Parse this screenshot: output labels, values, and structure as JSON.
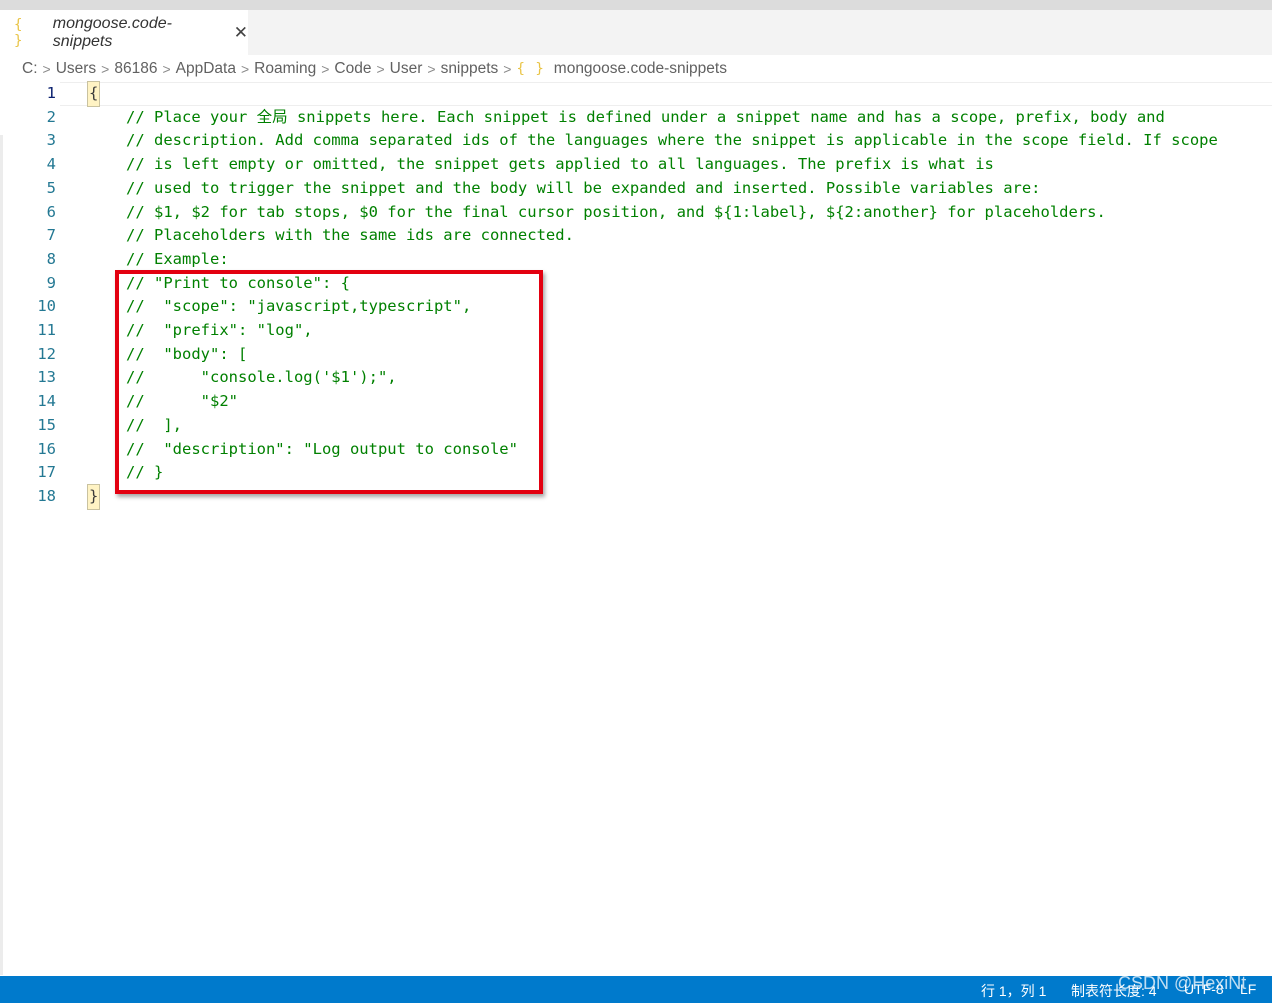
{
  "tab": {
    "icon": "{ }",
    "label": "mongoose.code-snippets",
    "close": "✕"
  },
  "breadcrumb": {
    "items": [
      "C:",
      "Users",
      "86186",
      "AppData",
      "Roaming",
      "Code",
      "User",
      "snippets"
    ],
    "file_icon": "{ }",
    "file": "mongoose.code-snippets"
  },
  "editor": {
    "lines": [
      {
        "num": "1",
        "text": "{"
      },
      {
        "num": "2",
        "text": "// Place your 全局 snippets here. Each snippet is defined under a snippet name and has a scope, prefix, body and"
      },
      {
        "num": "3",
        "text": "// description. Add comma separated ids of the languages where the snippet is applicable in the scope field. If scope"
      },
      {
        "num": "4",
        "text": "// is left empty or omitted, the snippet gets applied to all languages. The prefix is what is"
      },
      {
        "num": "5",
        "text": "// used to trigger the snippet and the body will be expanded and inserted. Possible variables are:"
      },
      {
        "num": "6",
        "text": "// $1, $2 for tab stops, $0 for the final cursor position, and ${1:label}, ${2:another} for placeholders."
      },
      {
        "num": "7",
        "text": "// Placeholders with the same ids are connected."
      },
      {
        "num": "8",
        "text": "// Example:"
      },
      {
        "num": "9",
        "text": "// \"Print to console\": {"
      },
      {
        "num": "10",
        "text": "//  \"scope\": \"javascript,typescript\","
      },
      {
        "num": "11",
        "text": "//  \"prefix\": \"log\","
      },
      {
        "num": "12",
        "text": "//  \"body\": ["
      },
      {
        "num": "13",
        "text": "//      \"console.log('$1');\","
      },
      {
        "num": "14",
        "text": "//      \"$2\""
      },
      {
        "num": "15",
        "text": "//  ],"
      },
      {
        "num": "16",
        "text": "//  \"description\": \"Log output to console\""
      },
      {
        "num": "17",
        "text": "// }"
      },
      {
        "num": "18",
        "text": "}"
      }
    ]
  },
  "status": {
    "position": "行 1，列 1",
    "indent": "制表符长度: 4",
    "encoding": "UTF-8",
    "eol": "LF"
  },
  "watermark": "CSDN @HexiNt"
}
